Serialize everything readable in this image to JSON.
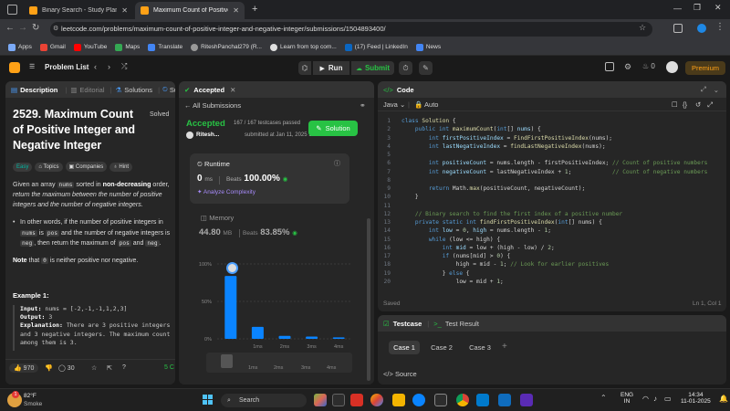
{
  "browser": {
    "tabs": [
      {
        "title": "Binary Search - Study Plan - Le",
        "active": false
      },
      {
        "title": "Maximum Count of Positive Inte",
        "active": true
      }
    ],
    "new_tab": "+",
    "url": "leetcode.com/problems/maximum-count-of-positive-integer-and-negative-integer/submissions/1504893400/",
    "bookmarks": [
      "Apps",
      "Gmail",
      "YouTube",
      "Maps",
      "Translate",
      "RiteshPanchal279 (R...",
      "Learn from top com...",
      "(17) Feed | LinkedIn",
      "News"
    ]
  },
  "lc_nav": {
    "problem_list": "Problem List",
    "run": "Run",
    "submit": "Submit",
    "streak": "0",
    "premium": "Premium"
  },
  "description": {
    "tabs": [
      "Description",
      "Editorial",
      "Solutions",
      "Su"
    ],
    "title": "2529. Maximum Count of Positive Integer and Negative Integer",
    "title_lines": [
      "2529. Maximum Count",
      "of Positive Integer and",
      "Negative Integer"
    ],
    "status": "Solved",
    "tags": [
      "Easy",
      "Topics",
      "Companies",
      "Hint"
    ],
    "p1_a": "Given an array",
    "p1_chip": "nums",
    "p1_b": "sorted in",
    "p1_bold": "non-decreasing",
    "p1_c": "order,",
    "p1_italic": "return the maximum between the number of positive integers and the number of negative integers.",
    "bullet_a": "In other words, if the number of positive integers in",
    "bullet_chip1": "nums",
    "bullet_b": "is",
    "bullet_chip2": "pos",
    "bullet_c": "and the number of negative integers is",
    "bullet_chip3": "neg",
    "bullet_d": ", then return the maximum of",
    "bullet_chip4": "pos",
    "bullet_e": "and",
    "bullet_chip5": "neg",
    "note_bold": "Note",
    "note_a": "that",
    "note_chip": "0",
    "note_b": "is neither positive nor negative.",
    "example_title": "Example 1:",
    "ex_input_label": "Input:",
    "ex_input": "nums = [-2,-1,-1,1,2,3]",
    "ex_output_label": "Output:",
    "ex_output": "3",
    "ex_expl_label": "Explanation:",
    "ex_expl": "There are 3 positive integers and 3 negative integers. The maximum count among them is 3.",
    "likes": "970",
    "comments": "30",
    "online": "5 C"
  },
  "submission": {
    "tab": "Accepted",
    "back": "All Submissions",
    "verdict": "Accepted",
    "testcases": "167 / 167 testcases passed",
    "user": "Ritesh...",
    "submitted": "submitted at Jan 11, 2025 14:32",
    "solution_btn": "Solution",
    "runtime_label": "Runtime",
    "runtime_value": "0",
    "runtime_unit": "ms",
    "beats_label": "Beats",
    "runtime_beats": "100.00%",
    "analyze": "Analyze Complexity",
    "memory_label": "Memory",
    "memory_value": "44.80",
    "memory_unit": "MB",
    "memory_beats": "83.85%",
    "chart_y_labels": [
      "100%",
      "50%",
      "0%"
    ],
    "chart_x_labels": [
      "1ms",
      "2ms",
      "3ms",
      "4ms"
    ],
    "mini_x_labels": [
      "1ms",
      "2ms",
      "3ms",
      "4ms"
    ]
  },
  "chart_data": {
    "type": "bar",
    "categories": [
      "0ms",
      "1ms",
      "2ms",
      "3ms",
      "4ms"
    ],
    "values": [
      84,
      16,
      4,
      3,
      2
    ],
    "ylim": [
      0,
      100
    ],
    "y_ticks": [
      "100%",
      "50%",
      "0%"
    ]
  },
  "code": {
    "title": "Code",
    "language": "Java",
    "auto": "Auto",
    "saved": "Saved",
    "cursor": "Ln 1, Col 1",
    "lines": [
      [
        [
          "kw",
          "class "
        ],
        [
          "fn",
          "Solution "
        ],
        [
          "",
          "{"
        ]
      ],
      [
        [
          "",
          "    "
        ],
        [
          "kw",
          "public int "
        ],
        [
          "fn",
          "maximumCount"
        ],
        [
          "",
          "("
        ],
        [
          "kw",
          "int"
        ],
        [
          "",
          "[] "
        ],
        [
          "var",
          "nums"
        ],
        [
          "",
          ") {"
        ]
      ],
      [
        [
          "",
          "        "
        ],
        [
          "kw",
          "int "
        ],
        [
          "var",
          "firstPositiveIndex"
        ],
        [
          "",
          " = "
        ],
        [
          "fn",
          "FindFirstPositiveIndex"
        ],
        [
          "",
          "(nums);"
        ]
      ],
      [
        [
          "",
          "        "
        ],
        [
          "kw",
          "int "
        ],
        [
          "var",
          "lastNegativeIndex"
        ],
        [
          "",
          " = "
        ],
        [
          "fn",
          "findLastNegativeIndex"
        ],
        [
          "",
          "(nums);"
        ]
      ],
      [
        [
          "",
          ""
        ]
      ],
      [
        [
          "",
          "        "
        ],
        [
          "kw",
          "int "
        ],
        [
          "var",
          "positiveCount"
        ],
        [
          "",
          " = nums.length - firstPositiveIndex; "
        ],
        [
          "cm",
          "// Count of positive numbers"
        ]
      ],
      [
        [
          "",
          "        "
        ],
        [
          "kw",
          "int "
        ],
        [
          "var",
          "negativeCount"
        ],
        [
          "",
          " = lastNegativeIndex + "
        ],
        [
          "num",
          "1"
        ],
        [
          "",
          ";            "
        ],
        [
          "cm",
          "// Count of negative numbers"
        ]
      ],
      [
        [
          "",
          ""
        ]
      ],
      [
        [
          "",
          "        "
        ],
        [
          "kw",
          "return "
        ],
        [
          "",
          "Math."
        ],
        [
          "fn",
          "max"
        ],
        [
          "",
          "(positiveCount, negativeCount);"
        ]
      ],
      [
        [
          "",
          "    }"
        ]
      ],
      [
        [
          "",
          ""
        ]
      ],
      [
        [
          "",
          "    "
        ],
        [
          "cm",
          "// Binary search to find the first index of a positive number"
        ]
      ],
      [
        [
          "",
          "    "
        ],
        [
          "kw",
          "private static int "
        ],
        [
          "fn",
          "findFirstPositiveIndex"
        ],
        [
          "",
          "("
        ],
        [
          "kw",
          "int"
        ],
        [
          "",
          "[] nums) {"
        ]
      ],
      [
        [
          "",
          "        "
        ],
        [
          "kw",
          "int "
        ],
        [
          "var",
          "low"
        ],
        [
          "",
          " = "
        ],
        [
          "num",
          "0"
        ],
        [
          "",
          ", "
        ],
        [
          "var",
          "high"
        ],
        [
          "",
          " = nums.length - "
        ],
        [
          "num",
          "1"
        ],
        [
          "",
          ";"
        ]
      ],
      [
        [
          "",
          "        "
        ],
        [
          "kw",
          "while "
        ],
        [
          "",
          "(low <= high) {"
        ]
      ],
      [
        [
          "",
          "            "
        ],
        [
          "kw",
          "int "
        ],
        [
          "var",
          "mid"
        ],
        [
          "",
          " = low + (high - low) / "
        ],
        [
          "num",
          "2"
        ],
        [
          "",
          ";"
        ]
      ],
      [
        [
          "",
          "            "
        ],
        [
          "kw",
          "if "
        ],
        [
          "",
          "(nums[mid] > "
        ],
        [
          "num",
          "0"
        ],
        [
          "",
          ") {"
        ]
      ],
      [
        [
          "",
          "                high = mid - "
        ],
        [
          "num",
          "1"
        ],
        [
          "",
          "; "
        ],
        [
          "cm",
          "// Look for earlier positives"
        ]
      ],
      [
        [
          "",
          "            } "
        ],
        [
          "kw",
          "else "
        ],
        [
          "",
          "{"
        ]
      ],
      [
        [
          "",
          "                low = mid + "
        ],
        [
          "num",
          "1"
        ],
        [
          "",
          ";"
        ]
      ],
      [
        [
          "",
          "            }"
        ]
      ]
    ]
  },
  "testcase": {
    "tab1": "Testcase",
    "tab2": "Test Result",
    "cases": [
      "Case 1",
      "Case 2",
      "Case 3"
    ],
    "add": "+",
    "source": "Source"
  },
  "taskbar": {
    "temp": "82°F",
    "weather": "Smoke",
    "search": "Search",
    "lang": "ENG",
    "region": "IN",
    "time": "14:34",
    "date": "11-01-2025",
    "badge": "1"
  }
}
